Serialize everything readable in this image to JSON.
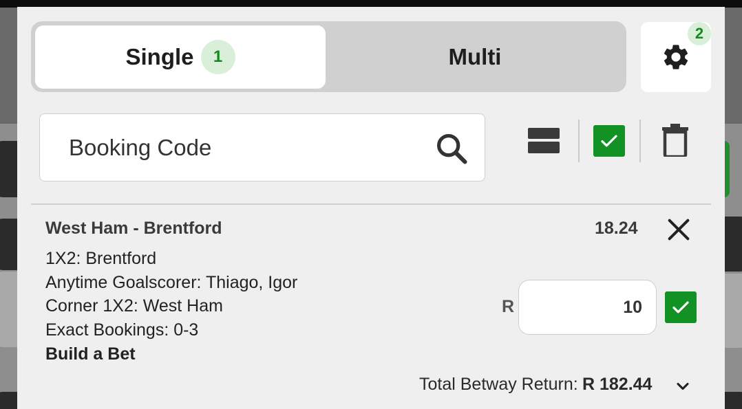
{
  "tabs": {
    "single_label": "Single",
    "single_count": "1",
    "multi_label": "Multi"
  },
  "settings": {
    "icon": "gear-icon",
    "badge": "2"
  },
  "booking": {
    "placeholder": "Booking Code",
    "icon": "search-icon"
  },
  "toolbar": {
    "icons": [
      "collapse-icon",
      "select-all-checkbox",
      "trash-icon"
    ]
  },
  "bet": {
    "match": "West Ham - Brentford",
    "odds": "18.24",
    "selections": [
      "1X2: Brentford",
      "Anytime Goalscorer: Thiago, Igor",
      "Corner 1X2: West Ham",
      "Exact Bookings: 0-3"
    ],
    "bet_type": "Build a Bet",
    "currency": "R",
    "stake": "10",
    "total_label": "Total Betway Return:",
    "total_value": "R 182.44"
  },
  "colors": {
    "accent_green": "#129125",
    "badge_bg": "#d9efd9",
    "badge_text": "#138a1c"
  }
}
